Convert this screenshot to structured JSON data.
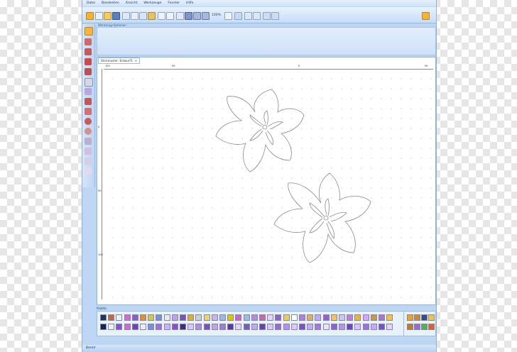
{
  "menu": [
    "Datei",
    "Bearbeiten",
    "Ansicht",
    "Werkzeuge",
    "Fenster",
    "Hilfe"
  ],
  "toolbar": {
    "zoom": "100%"
  },
  "options_panel": {
    "title": "Werkzeug-Optionen"
  },
  "document": {
    "tab_label": "Stickmuster: Entwurf1",
    "close": "×"
  },
  "ruler": {
    "top_ticks": [
      "100",
      "50",
      "0",
      "50"
    ],
    "left_ticks": [
      "0",
      "50",
      "100"
    ]
  },
  "palette": {
    "title": "Palette"
  },
  "statusbar": {
    "text": "Bereit"
  },
  "colors": {
    "app_frame": "#bcd6f3",
    "palette_row1": [
      "#2a2f5a",
      "#c06a3d",
      "#f0f0f0",
      "#d46ad0",
      "#8c5dc2",
      "#e88c2c",
      "#d6c650",
      "#7a8fd8",
      "#eaeaea",
      "#c4a0e8",
      "#7b53b4",
      "#e6aa2a",
      "#d0d0d0",
      "#f0d070",
      "#cbb3e6",
      "#9fb4e8",
      "#e0c400",
      "#d85fc8",
      "#a3b8e6",
      "#b58be0",
      "#cc66aa",
      "#e8d2f5",
      "#8e65c6",
      "#f2ca54",
      "#ffffff",
      "#b080d6",
      "#e0b060",
      "#c5a8ff",
      "#9b5ed0",
      "#f5c35a",
      "#d2c2f0",
      "#c07fd8",
      "#f7b030",
      "#e0a0ff",
      "#cf9640",
      "#a777cf",
      "#ffbf3a"
    ],
    "palette_row2": [
      "#1c2250",
      "#f0f0f0",
      "#8a52c8",
      "#d46ad0",
      "#6e44b6",
      "#efe6ff",
      "#7a8fd8",
      "#a070d8",
      "#c9b4f0",
      "#8a52c8",
      "#3e2e7a",
      "#d8c8f8",
      "#b58be0",
      "#7b53b4",
      "#c4a0e8",
      "#9f7bd4",
      "#5d3a9a",
      "#e8d2f5",
      "#7a59b8",
      "#bfa8ec",
      "#6a40b0",
      "#dfc4ff",
      "#9a6ad0",
      "#b68df0",
      "#e0c8ff",
      "#7c51c2",
      "#caa8f0",
      "#a677dd",
      "#f0e0ff",
      "#8c64d0",
      "#b990ef",
      "#6e48b8",
      "#dac0ff",
      "#9c6ee0",
      "#c8a6ff",
      "#7753bf",
      "#e6d2ff"
    ],
    "palette_right": [
      "#f7a020",
      "#d08a2e",
      "#3b4a8a",
      "#f4c24a",
      "#c27a2a",
      "#9a6ad0",
      "#58b048",
      "#e06030"
    ]
  }
}
